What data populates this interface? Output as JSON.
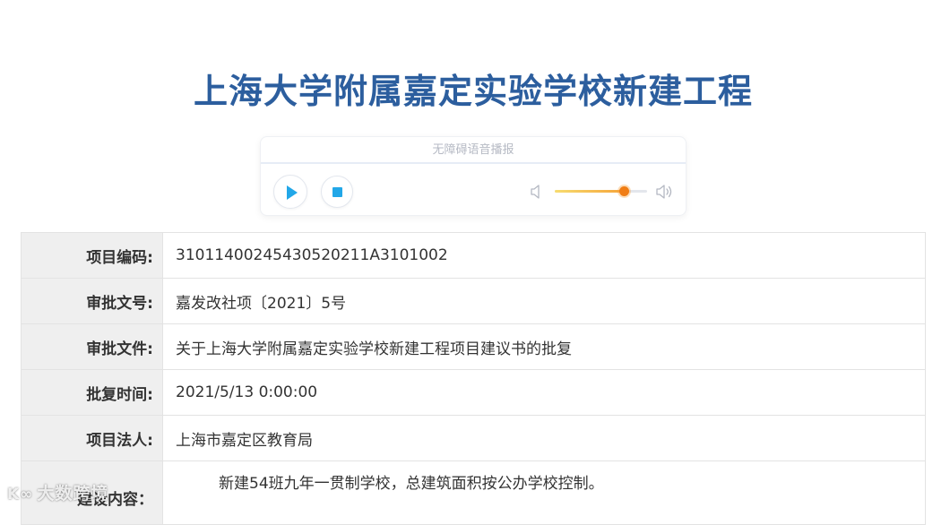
{
  "page": {
    "title": "上海大学附属嘉定实验学校新建工程"
  },
  "audio_player": {
    "header_label": "无障碍语音播报",
    "volume_level": 0.75,
    "accent_color": "#22a7e8",
    "icons": {
      "play": "play-icon",
      "stop": "stop-icon",
      "volume_low": "volume-low-icon",
      "volume_high": "volume-high-icon"
    }
  },
  "details": {
    "rows": [
      {
        "label": "项目编码:",
        "value": "31011400245430520211A3101002"
      },
      {
        "label": "审批文号:",
        "value": "嘉发改社项〔2021〕5号"
      },
      {
        "label": "审批文件:",
        "value": "关于上海大学附属嘉定实验学校新建工程项目建议书的批复"
      },
      {
        "label": "批复时间:",
        "value": "2021/5/13 0:00:00"
      },
      {
        "label": "项目法人:",
        "value": "上海市嘉定区教育局"
      },
      {
        "label": "建设内容：",
        "value": "新建54班九年一贯制学校，总建筑面积按公办学校控制。"
      }
    ]
  },
  "watermark": {
    "logo": "K∞",
    "text": "大数跨境"
  },
  "colors": {
    "title": "#2c5e9e",
    "label_bg": "#efefef",
    "border": "#e3e3e3"
  }
}
